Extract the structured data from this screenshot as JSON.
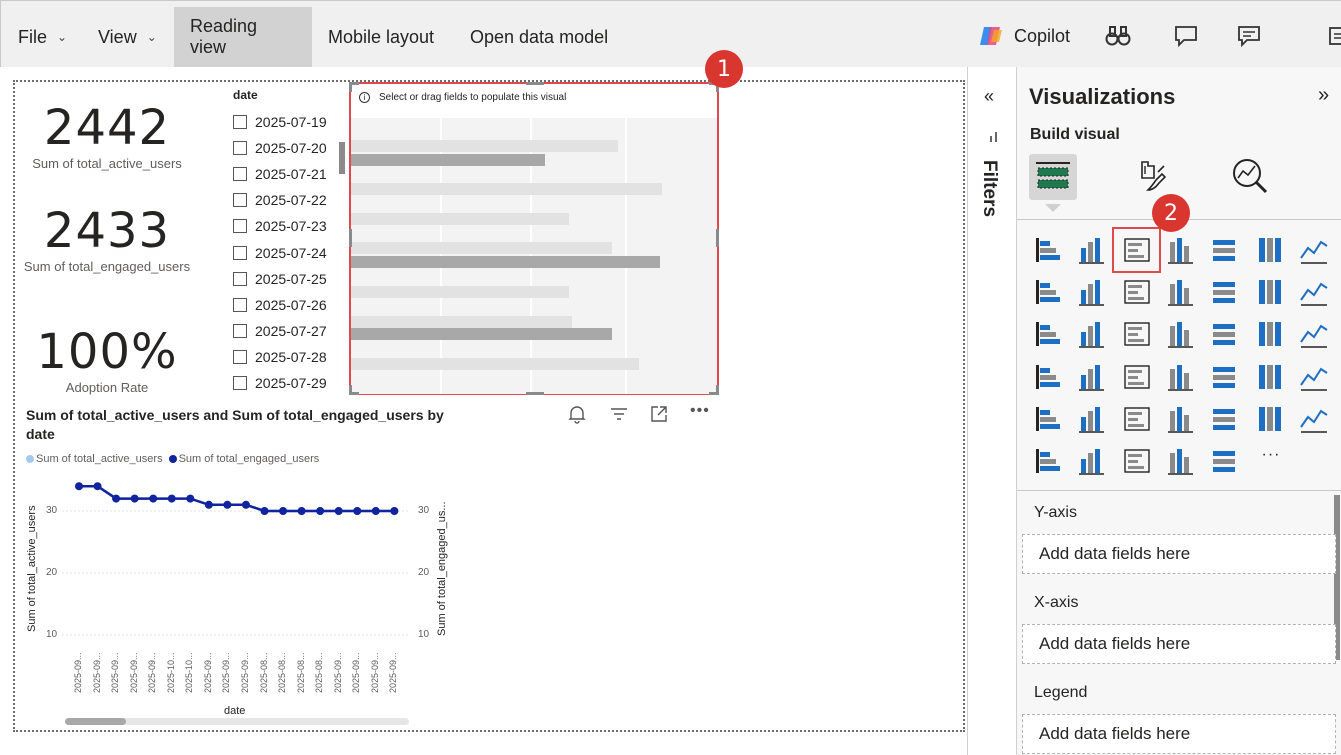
{
  "menu": {
    "file": "File",
    "view": "View",
    "reading_view": "Reading view",
    "mobile_layout": "Mobile layout",
    "open_data_model": "Open data model",
    "copilot": "Copilot"
  },
  "kpis": [
    {
      "value": "2442",
      "label": "Sum of total_active_users"
    },
    {
      "value": "2433",
      "label": "Sum of total_engaged_users"
    },
    {
      "value": "100%",
      "label": "Adoption Rate"
    }
  ],
  "slicer": {
    "title": "date",
    "items": [
      "2025-07-19",
      "2025-07-20",
      "2025-07-21",
      "2025-07-22",
      "2025-07-23",
      "2025-07-24",
      "2025-07-25",
      "2025-07-26",
      "2025-07-27",
      "2025-07-28",
      "2025-07-29"
    ]
  },
  "placeholder": {
    "message": "Select or drag fields to populate this visual",
    "badge": "1"
  },
  "line_chart": {
    "title_line1": "Sum of total_active_users and Sum of total_engaged_users by",
    "title_line2": "date",
    "legend": [
      "Sum of total_active_users",
      "Sum of total_engaged_users"
    ],
    "y_left_label": "Sum of total_active_users",
    "y_right_label": "Sum of total_engaged_us...",
    "x_label": "date",
    "y_ticks": [
      "30",
      "20",
      "10"
    ],
    "x_ticks": [
      "2025-09...",
      "2025-09...",
      "2025-09...",
      "2025-09...",
      "2025-09...",
      "2025-10...",
      "2025-10...",
      "2025-09...",
      "2025-09...",
      "2025-09...",
      "2025-08...",
      "2025-08...",
      "2025-08...",
      "2025-08...",
      "2025-09...",
      "2025-09...",
      "2025-09...",
      "2025-09..."
    ]
  },
  "chart_data": {
    "type": "line",
    "title": "Sum of total_active_users and Sum of total_engaged_users by date",
    "xlabel": "date",
    "ylabel": "Sum of total_active_users",
    "ylim": [
      10,
      35
    ],
    "categories": [
      "2025-09...",
      "2025-09...",
      "2025-09...",
      "2025-09...",
      "2025-09...",
      "2025-10...",
      "2025-10...",
      "2025-09...",
      "2025-09...",
      "2025-09...",
      "2025-08...",
      "2025-08...",
      "2025-08...",
      "2025-08...",
      "2025-09...",
      "2025-09...",
      "2025-09...",
      "2025-09..."
    ],
    "series": [
      {
        "name": "Sum of total_active_users",
        "values": [
          34,
          34,
          32,
          32,
          32,
          32,
          32,
          31,
          31,
          31,
          30,
          30,
          30,
          30,
          30,
          30,
          30,
          30
        ]
      },
      {
        "name": "Sum of total_engaged_users",
        "values": [
          34,
          34,
          32,
          32,
          32,
          32,
          32,
          31,
          31,
          31,
          30,
          30,
          30,
          30,
          30,
          30,
          30,
          30
        ]
      }
    ],
    "colors": {
      "active": "#a6c8f0",
      "engaged": "#12239e"
    }
  },
  "panel": {
    "filters": "Filters",
    "title": "Visualizations",
    "build_visual": "Build visual",
    "badge": "2",
    "more": "···",
    "wells": [
      {
        "label": "Y-axis",
        "placeholder": "Add data fields here"
      },
      {
        "label": "X-axis",
        "placeholder": "Add data fields here"
      },
      {
        "label": "Legend",
        "placeholder": "Add data fields here"
      }
    ]
  }
}
